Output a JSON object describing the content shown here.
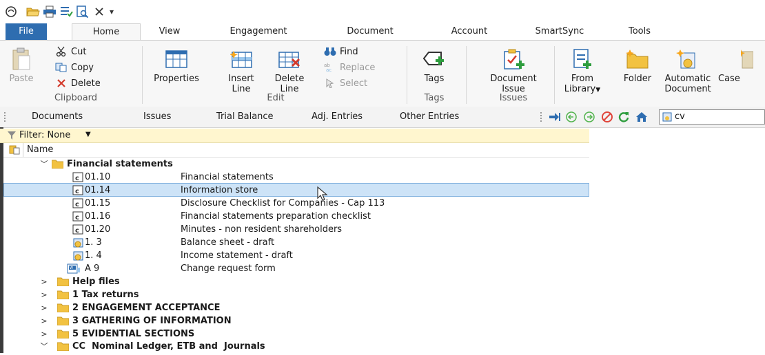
{
  "qat": {
    "icons": [
      "app-logo-icon",
      "open-folder-icon",
      "print-icon",
      "checklist-icon",
      "print-preview-icon",
      "close-x-icon",
      "customize-qat-icon"
    ],
    "customize_glyph": "▾"
  },
  "tabs": [
    "File",
    "Home",
    "View",
    "Engagement",
    "Document",
    "Account",
    "SmartSync",
    "Tools"
  ],
  "ribbon": {
    "clipboard": {
      "paste": "Paste",
      "cut": "Cut",
      "copy": "Copy",
      "delete": "Delete",
      "label": "Clipboard"
    },
    "edit": {
      "properties": "Properties",
      "insert_line_1": "Insert",
      "insert_line_2": "Line",
      "delete_line_1": "Delete",
      "delete_line_2": "Line",
      "find": "Find",
      "replace": "Replace",
      "select": "Select",
      "label": "Edit"
    },
    "tags": {
      "tags": "Tags",
      "label": "Tags"
    },
    "issues": {
      "doc_issue_1": "Document",
      "doc_issue_2": "Issue",
      "label": "Issues"
    },
    "new": {
      "from_library_1": "From",
      "from_library_2": "Library",
      "folder": "Folder",
      "automatic_1": "Automatic",
      "automatic_2": "Document",
      "case": "Case"
    }
  },
  "navbar": {
    "tabs": [
      "Documents",
      "Issues",
      "Trial Balance",
      "Adj. Entries",
      "Other Entries"
    ],
    "icons": [
      "jump-to-icon",
      "back-icon",
      "forward-icon",
      "stop-icon",
      "refresh-icon",
      "home-icon"
    ],
    "client_short": "cv"
  },
  "filter": {
    "label": "Filter: None",
    "dropdown": "▼"
  },
  "column": {
    "name": "Name"
  },
  "tree": {
    "fs_folder": "Financial statements",
    "fs_items": [
      {
        "code": "01.10",
        "title": "Financial statements",
        "type": "c"
      },
      {
        "code": "01.14",
        "title": "Information store",
        "type": "c"
      },
      {
        "code": "01.15",
        "title": "Disclosure Checklist for Companies - Cap 113",
        "type": "c"
      },
      {
        "code": "01.16",
        "title": "Financial statements preparation checklist",
        "type": "c"
      },
      {
        "code": "01.20",
        "title": "Minutes - non resident shareholders",
        "type": "c"
      },
      {
        "code": "1. 3",
        "title": "Balance sheet - draft",
        "type": "auto"
      },
      {
        "code": "1. 4",
        "title": "Income statement - draft",
        "type": "auto"
      },
      {
        "code": "A 9",
        "title": "Change request form",
        "type": "w"
      }
    ],
    "folders": [
      "Help files",
      "1 Tax returns",
      "2 ENGAGEMENT ACCEPTANCE",
      "3 GATHERING OF INFORMATION",
      "5 EVIDENTIAL SECTIONS",
      "CC  Nominal Ledger, ETB and  Journals"
    ]
  },
  "colors": {
    "file_tab": "#2e6db0",
    "selection": "#cde3f7",
    "filter_bg": "#fff6cf",
    "folder": "#f2c241"
  }
}
